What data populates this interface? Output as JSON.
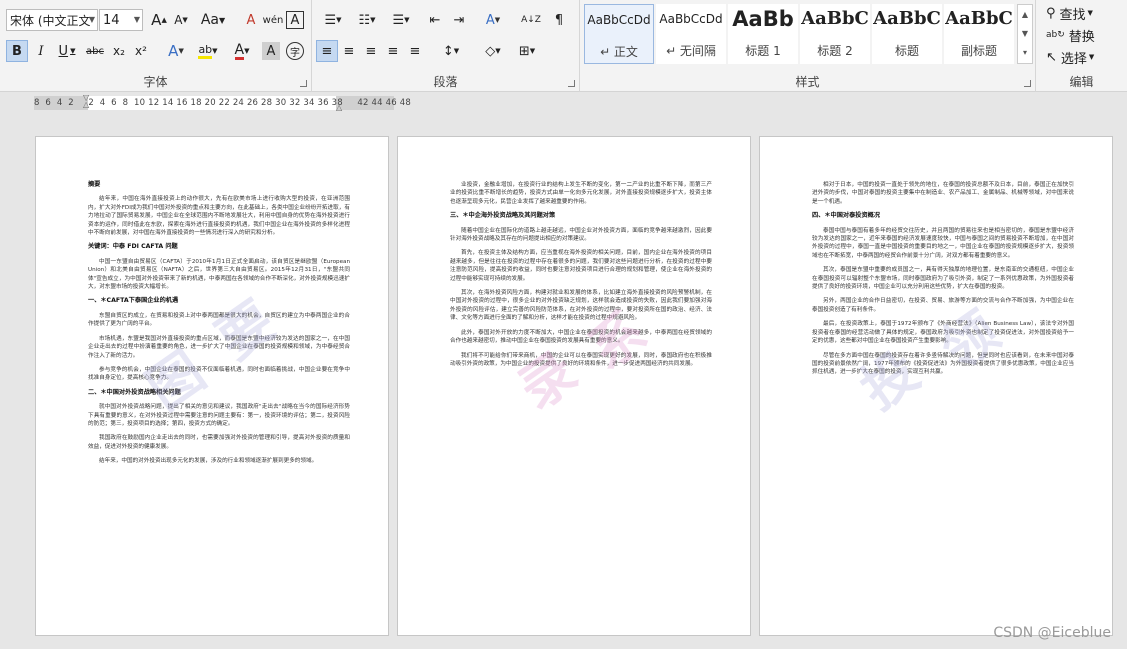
{
  "ribbon": {
    "font_group": {
      "label": "字体",
      "font_name": "宋体 (中文正文)",
      "font_size": "14",
      "grow": "A",
      "shrink": "A",
      "change_case": "Aa",
      "clear": "A",
      "phonetic": "wén",
      "border_char": "A",
      "bold": "B",
      "italic": "I",
      "underline": "U",
      "strike": "abc",
      "subscript": "x₂",
      "superscript": "x²",
      "effects": "A",
      "highlight": "ab",
      "font_color": "A",
      "shade": "A",
      "circle": "字"
    },
    "para_group": {
      "label": "段落",
      "bullets": "☰",
      "numbering": "☷",
      "multilevel": "☰",
      "dec_indent": "⇤",
      "inc_indent": "⇥",
      "chinese_layout": "A",
      "sort": "A↓Z",
      "show_marks": "¶",
      "align_left": "≡",
      "align_center": "≡",
      "align_right": "≡",
      "justify": "≡",
      "distributed": "≡",
      "line_spacing": "↕",
      "shading": "◇",
      "borders": "⊞"
    },
    "styles_group": {
      "label": "样式",
      "styles": [
        {
          "preview": "AaBbCcDd",
          "name": "↵ 正文"
        },
        {
          "preview": "AaBbCcDd",
          "name": "↵ 无间隔"
        },
        {
          "preview": "AaBb",
          "name": "标题 1"
        },
        {
          "preview": "AaBbC",
          "name": "标题 2"
        },
        {
          "preview": "AaBbC",
          "name": "标题"
        },
        {
          "preview": "AaBbC",
          "name": "副标题"
        }
      ]
    },
    "editing_group": {
      "label": "编辑",
      "find": "查找",
      "replace": "替换",
      "select": "选择"
    }
  },
  "ruler": {
    "text": "8  6  4  2     2  4  6  8  10 12 14 16 18 20 22 24 26 28 30 32 34 36 38     42 44 46 48"
  },
  "page1": {
    "title": "摘要",
    "p1": "结年来，中国在海外直接投资上的动作很大，先有在欧美市场上进行收购大型的投资，在亚洲范围内，扩大对外FDI成为我们中国对外投资的重点和主要方向，在此基础上，各类中国企业纷纷开拓进取，有力地拉动了国际贸易发展，中国企业在全球范围内不断地发展壮大，利用中国自身的优势在海外投资进行资本的运作，同时借此在东欧，探索在海外进行直接投资的机遇，我们中国企业在海外投资的多样化进程中不断向前发展，对中国在海外直接投资的一些情况进行深入的研究和分析。",
    "keywords": "关键词：中泰 FDI CAFTA 问题",
    "p2": "中国一东盟自由贸易区（CAFTA）于2010年1月1日正式全面启动，该自贸区是继欧盟（European Union）和北美自由贸易区（NAFTA）之后，世界第三大自由贸易区。2015年12月31日，\"东盟共同体\"宣告成立，为中国对外投资带来了新的机遇，中泰两国在各领域的合作不断深化，对外投资规模迅速扩大，对东盟市场的投资大幅增长。",
    "h1": "一、＊CAFTA下泰国企业的机遇",
    "p3": "东盟自贸区的成立，在贸易和投资上对中泰两国都是很大的机会，自贸区的建立为中泰两国企业的合作提供了更为广阔的平台。",
    "p4": "市场机遇，东盟是我国对外直接投资的重点区域，而泰国是东盟中经济较为发达的国家之一，在中国企业走出去的过程中扮演着重要的角色，进一步扩大了中国企业在泰国的投资规模和领域，为中泰经贸合作注入了新的活力。",
    "p5": "参与竞争的机会，中国企业在泰国的投资不仅面临着机遇，同时也面临着挑战，中国企业要在竞争中找准自身定位，提高核心竞争力。",
    "h2": "二、＊中国对外投资战略相关问题",
    "p6": "就中国对外投资战略问题，提出了相关的意见和建议，我国政府\"走出去\"战略在当今的国际经济形势下具有重要的意义，在对外投资过程中需要注意的问题主要有：第一，投资环境的评估；第二，投资风险的防范；第三，投资项目的选择；第四，投资方式的确定。",
    "p7": "我国政府在鼓励国内企业走出去的同时，也需要加强对外投资的管理和引导，提高对外投资的质量和效益，促进对外投资的健康发展。",
    "p8": "结年来，中国的对外投资出现多元化的发展，涉及的行业和领域逐渐扩展到更多的领域。"
  },
  "page2": {
    "p1": "业投资，金融业增加，在投资行业的结构上发生不断的变化，第一二产业的比重不断下降，而第三产业的投资比重不断增长的趋势，投资方式由单一化向多元化发展，对外直接投资规模逐步扩大，投资主体也逐渐呈现多元化，民营企业发挥了越来越重要的作用。",
    "h1": "三、＊中企海外投资战略及其问题对策",
    "p2": "随着中国企业在国际化的道路上越走越远，中国企业对外投资方面，面临的竞争越来越激烈，因此要针对海外投资战略及其存在的问题提出相应的对策建议。",
    "p3": "首先，在投资主体及结构方面，应当重视在海外投资的相关问题，目前，国内企业在海外投资的项目越来越多，但是往往在投资的过程中存在着很多的问题，我们要对这些问题进行分析，在投资的过程中要注意防范风险，提高投资的收益，同时也要注意对投资项目进行合理的规划和管理，使企业在海外投资的过程中能够实现可持续的发展。",
    "p4": "其次，在海外投资风险方面，构建对就业和发展的体系，比如建立海外直接投资的风险预警机制，在中国对外投资的过程中，很多企业的对外投资缺乏规划，这样就会造成投资的失败，因此我们要加强对海外投资的风险评估，建立完善的风险防范体系，在对外投资的过程中，要对投资所在国的政治、经济、法律、文化等方面进行全面的了解和分析，这样才能在投资的过程中规避风险。",
    "p5": "此外，泰国对外开放的力度不断加大，中国企业在泰国投资的机会越来越多，中泰两国在经贸领域的合作也越来越密切，推动中国企业在泰国投资的发展具有重要的意义。",
    "p6": "我们将不可能给你们带来商机，中国的企业可以在泰国实现更好的发展，同时，泰国政府也在积极推动吸引外资的政策，为中国企业的投资提供了良好的环境和条件，进一步促进两国经济的共同发展。"
  },
  "page3": {
    "p1": "相对于日本，中国的投资一直处于领先的地位，在泰国的投资总额不及日本，目前，泰国正在加快引进外资的步伐，中国对泰国的投资主要集中在制造业、农产品加工、金属制品、机械等领域，对中国来说是一个机遇。",
    "h1": "四、＊中国对泰投资概况",
    "p2": "泰国中国与泰国有着多年的经贸交往历史，并且两国的贸易往来也是相当密切的，泰国是东盟中经济较为发达的国家之一，近年来泰国的经济发展速度较快，中国与泰国之间的贸易投资不断增加，在中国对外投资的过程中，泰国一直是中国投资的重要目的地之一，中国企业在泰国的投资规模逐步扩大，投资领域也在不断拓宽，中泰两国的经贸合作前景十分广阔，对双方都有着重要的意义。",
    "p3": "其次，泰国是东盟中重要的成员国之一，具有得天独厚的地理位置，是东南亚的交通枢纽，中国企业在泰国投资可以辐射整个东盟市场，同时泰国政府为了吸引外资，制定了一系列优惠政策，为外国投资者提供了良好的投资环境，中国企业可以充分利用这些优势，扩大在泰国的投资。",
    "p4": "另外，两国企业的合作日益密切，在投资、贸易、旅游等方面的交流与合作不断加强，为中国企业在泰国投资创造了有利条件。",
    "p5": "最后，在投资政策上，泰国于1972年颁布了《外商经营法》（Alien Business Law），该法令对外国投资者在泰国的经营活动做了具体的规定，泰国政府为吸引外资也制定了投资促进法，对外国投资给予一定的优惠，这些都对中国企业在泰国投资产生重要影响。",
    "p6": "尽管在多方面中国在泰国的投资存在着许多亟待解决的问题，但是同时也应该看到，在未来中国对泰国的投资前景依然广阔，1977年颁布的《投资促进法》为外国投资者提供了很多优惠政策，中国企业应当抓住机遇，进一步扩大在泰国的投资，实现互利共赢。"
  },
  "watermarks": [
    "图",
    "要",
    "录",
    "系",
    "投",
    "领"
  ],
  "footer": {
    "credit": "CSDN @Eiceblue"
  }
}
